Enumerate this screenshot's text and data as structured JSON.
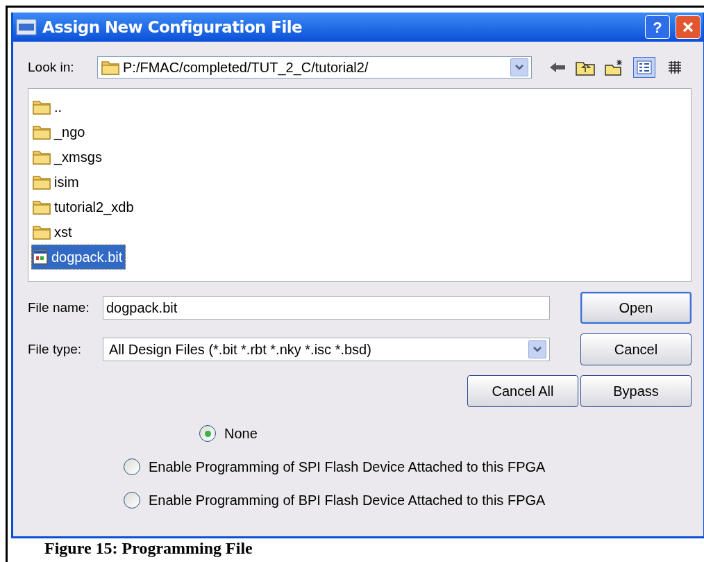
{
  "window": {
    "title": "Assign New Configuration File",
    "help_glyph": "?"
  },
  "look_in": {
    "label": "Look in:",
    "value": "P:/FMAC/completed/TUT_2_C/tutorial2/"
  },
  "views": [
    {
      "kind": "details",
      "selected": true
    },
    {
      "kind": "list",
      "selected": false
    }
  ],
  "files": [
    {
      "kind": "folder",
      "name": "..",
      "selected": false
    },
    {
      "kind": "folder",
      "name": "_ngo",
      "selected": false
    },
    {
      "kind": "folder",
      "name": "_xmsgs",
      "selected": false
    },
    {
      "kind": "folder",
      "name": "isim",
      "selected": false
    },
    {
      "kind": "folder",
      "name": "tutorial2_xdb",
      "selected": false
    },
    {
      "kind": "folder",
      "name": "xst",
      "selected": false
    },
    {
      "kind": "file",
      "name": "dogpack.bit",
      "selected": true
    }
  ],
  "file_name": {
    "label": "File name:",
    "value": "dogpack.bit"
  },
  "file_type": {
    "label": "File type:",
    "value": "All Design Files (*.bit *.rbt *.nky *.isc *.bsd)"
  },
  "buttons": {
    "open": {
      "label": "Open",
      "default": true
    },
    "cancel": {
      "label": "Cancel",
      "default": false
    },
    "cancel_all": {
      "label": "Cancel All",
      "default": false
    },
    "bypass": {
      "label": "Bypass",
      "default": false
    }
  },
  "options": [
    {
      "label": "None",
      "selected": true
    },
    {
      "label": "Enable Programming of SPI Flash Device Attached to this FPGA",
      "selected": false
    },
    {
      "label": "Enable Programming of BPI Flash Device Attached to this FPGA",
      "selected": false
    }
  ],
  "caption": "Figure 15: Programming File"
}
